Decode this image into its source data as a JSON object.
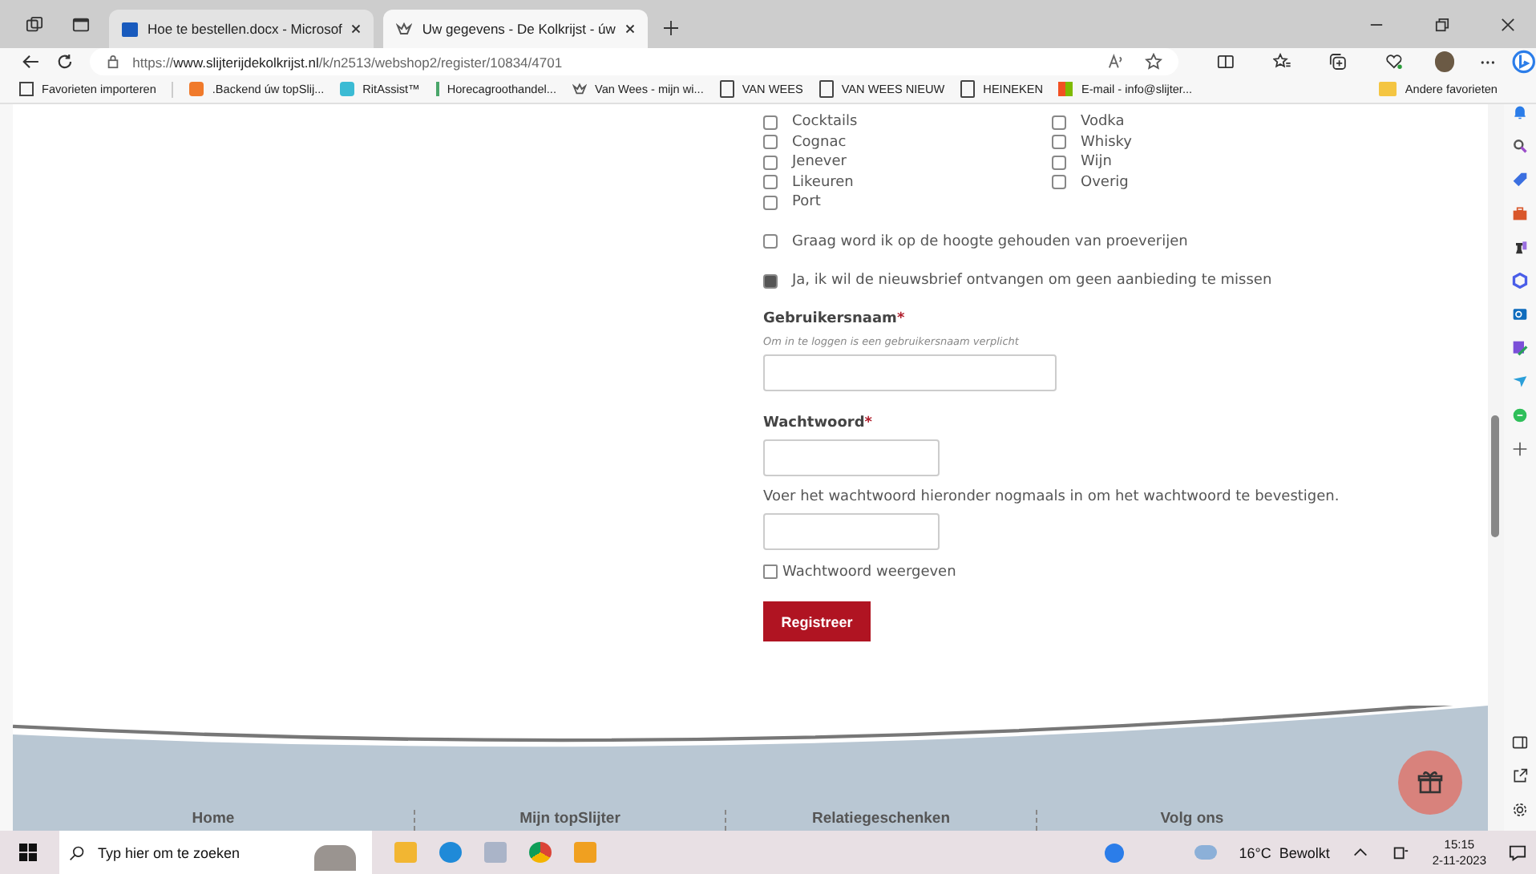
{
  "tabs": [
    {
      "title": "Hoe te bestellen.docx - Microsof",
      "selected": false,
      "kind": "word"
    },
    {
      "title": "Uw gegevens - De Kolkrijst - úw",
      "selected": true,
      "kind": "crown"
    }
  ],
  "address": {
    "prefix": "https://",
    "domain": "www.slijterijdekolkrijst.nl",
    "path": "/k/n2513/webshop2/register/10834/4701"
  },
  "bookmarks": [
    {
      "label": "Favorieten importeren",
      "kind": "import"
    },
    {
      "label": ".Backend úw topSlij...",
      "kind": "orange"
    },
    {
      "label": "RitAssist™",
      "kind": "teal"
    },
    {
      "label": "Horecagroothandel...",
      "kind": "bar"
    },
    {
      "label": "Van Wees - mijn wi...",
      "kind": "crown"
    },
    {
      "label": "VAN WEES",
      "kind": "page"
    },
    {
      "label": "VAN WEES NIEUW",
      "kind": "page"
    },
    {
      "label": "HEINEKEN",
      "kind": "page"
    },
    {
      "label": "E-mail - info@slijter...",
      "kind": "ms"
    }
  ],
  "other_favorites": "Andere favorieten",
  "categories_left": [
    {
      "label": "Cocktails",
      "checked": false
    },
    {
      "label": "Cognac",
      "checked": false
    },
    {
      "label": "Jenever",
      "checked": false
    },
    {
      "label": "Likeuren",
      "checked": false
    },
    {
      "label": "Port",
      "checked": false
    }
  ],
  "categories_right": [
    {
      "label": "Vodka",
      "checked": false
    },
    {
      "label": "Whisky",
      "checked": false
    },
    {
      "label": "Wijn",
      "checked": false
    },
    {
      "label": "Overig",
      "checked": false
    }
  ],
  "options": [
    {
      "label": "Graag word ik op de hoogte gehouden van proeverijen",
      "checked": false
    },
    {
      "label": "Ja, ik wil de nieuwsbrief ontvangen om geen aanbieding te missen",
      "checked": true
    }
  ],
  "username": {
    "label": "Gebruikersnaam",
    "required": "*",
    "hint": "Om in te loggen is een gebruikersnaam verplicht"
  },
  "password": {
    "label": "Wachtwoord",
    "required": "*"
  },
  "confirm_text": "Voer het wachtwoord hieronder nogmaals in om het wachtwoord te bevestigen.",
  "show_password": {
    "label": "Wachtwoord weergeven",
    "checked": false
  },
  "submit": "Registreer",
  "footer_links": [
    "Home",
    "Mijn topSlijter",
    "Relatiegeschenken",
    "Volg ons"
  ],
  "taskbar": {
    "search_placeholder": "Typ hier om te zoeken",
    "weather": "16°C  Bewolkt",
    "time": "15:15",
    "date": "2-11-2023"
  }
}
